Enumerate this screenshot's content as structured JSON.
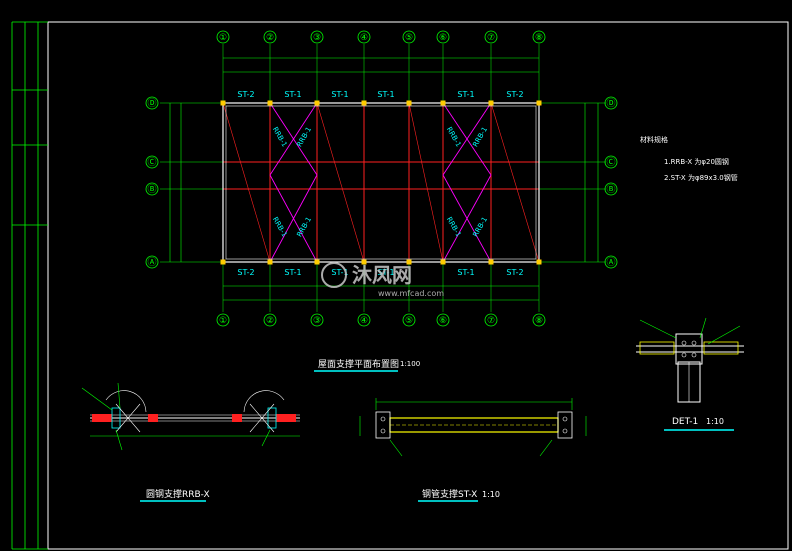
{
  "colors": {
    "background": "#000000",
    "frame": "#ffffff",
    "axis": "#00ff00",
    "grid_red": "#ff2020",
    "bracing": "#ff00ff",
    "label": "#00ffff",
    "node": "#ffcc00",
    "title_block": "#00ff00",
    "detail_yellow": "#ffff00",
    "watermark": "#c8c8c8"
  },
  "axes": {
    "columns": [
      "①",
      "②",
      "③",
      "④",
      "⑤",
      "⑥",
      "⑦",
      "⑧"
    ],
    "rows": [
      "Ⓓ",
      "Ⓒ",
      "Ⓑ",
      "Ⓐ"
    ]
  },
  "member_labels": {
    "top": [
      "ST-2",
      "ST-1",
      "ST-1",
      "ST-1",
      "ST-1",
      "ST-2"
    ],
    "bottom": [
      "ST-2",
      "ST-1",
      "ST-1",
      "ST-1",
      "ST-1",
      "ST-2"
    ],
    "bracing": "RRB-1"
  },
  "notes": {
    "heading": "材料规格",
    "line1": "1.RRB-X 为φ20圆钢",
    "line2": "2.ST-X 为φ89x3.0钢管"
  },
  "titles": {
    "plan": "屋面支撑平面布置图",
    "plan_scale": "1:100",
    "detail_a": "圆钢支撑RRB-X",
    "detail_b": "钢管支撑ST-X",
    "detail_b_scale": "1:10",
    "detail_c": "DET-1",
    "detail_c_scale": "1:10"
  },
  "watermark": {
    "brand": "沐风网",
    "url": "www.mfcad.com"
  }
}
